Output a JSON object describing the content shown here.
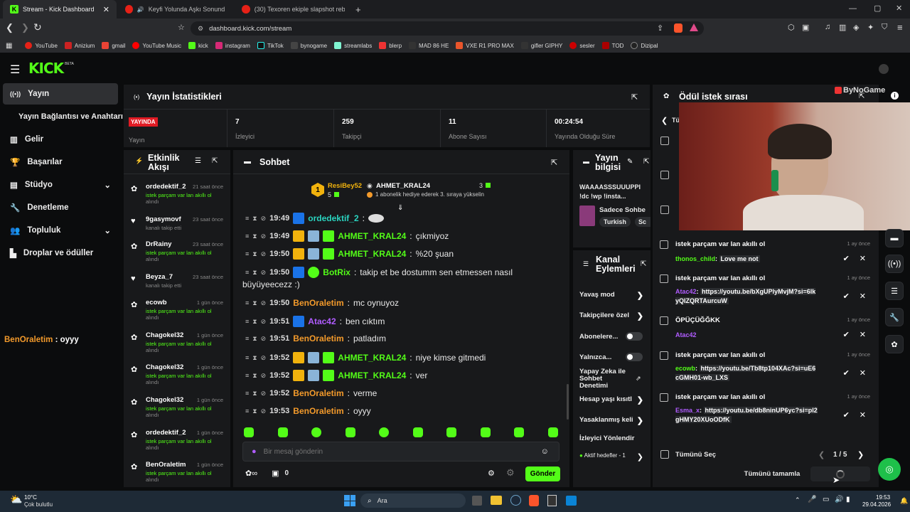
{
  "browser": {
    "tabs": [
      {
        "title": "Stream - Kick Dashboard",
        "active": true
      },
      {
        "title": "Keyfi Yolunda Aşkı Sonunda | Yo",
        "active": false
      },
      {
        "title": "(30) Texoren ekiple slapshot rebound",
        "active": false
      }
    ],
    "url": "dashboard.kick.com/stream",
    "bookmarks": [
      "YouTube",
      "Anizium",
      "gmail",
      "YouTube Music",
      "kick",
      "instagram",
      "TikTok",
      "bynogame",
      "streamlabs",
      "blerp",
      "MAD 86 HE",
      "VXE R1 PRO MAX",
      "gifler GIPHY",
      "sesler",
      "TOD",
      "Dizipal"
    ]
  },
  "app": {
    "logo": "KICK",
    "logo_sup": "BETA"
  },
  "sidebar": {
    "items": [
      {
        "label": "Yayın",
        "icon": "broadcast-icon"
      },
      {
        "label": "Yayın Bağlantısı ve Anahtarı",
        "icon": ""
      },
      {
        "label": "Gelir",
        "icon": "chart-icon"
      },
      {
        "label": "Başarılar",
        "icon": "trophy-icon"
      },
      {
        "label": "Stüdyo",
        "icon": "monitor-icon"
      },
      {
        "label": "Denetleme",
        "icon": "wrench-icon"
      },
      {
        "label": "Topluluk",
        "icon": "people-icon"
      },
      {
        "label": "Droplar ve ödüller",
        "icon": "gift-icon"
      }
    ],
    "overlay_chat": {
      "user": "BenOraletim",
      "text": " : oyyy"
    }
  },
  "stats": {
    "title": "Yayın İstatistikleri",
    "live_badge": "YAYINDA",
    "live_label": "Yayın",
    "items": [
      {
        "value": "7",
        "label": "İzleyici"
      },
      {
        "value": "259",
        "label": "Takipçi"
      },
      {
        "value": "11",
        "label": "Abone Sayısı"
      },
      {
        "value": "00:24:54",
        "label": "Yayında Olduğu Süre"
      }
    ]
  },
  "activity": {
    "title": "Etkinlik Akışı",
    "items": [
      {
        "name": "ordedektif_2",
        "time": "21 saat önce",
        "sub": "istek parçam var lan akıllı ol",
        "sub2": "alındı",
        "type": "reward"
      },
      {
        "name": "9gasymovf",
        "time": "23 saat önce",
        "sub": "",
        "sub2": "kanalı takip etti",
        "type": "follow"
      },
      {
        "name": "DrRainy",
        "time": "23 saat önce",
        "sub": "istek parçam var lan akıllı ol",
        "sub2": "alındı",
        "type": "reward"
      },
      {
        "name": "Beyza_7",
        "time": "23 saat önce",
        "sub": "",
        "sub2": "kanalı takip etti",
        "type": "follow"
      },
      {
        "name": "ecowb",
        "time": "1 gün önce",
        "sub": "istek parçam var lan akıllı ol",
        "sub2": "alındı",
        "type": "reward"
      },
      {
        "name": "Chagokel32",
        "time": "1 gün önce",
        "sub": "istek parçam var lan akıllı ol",
        "sub2": "alındı",
        "type": "reward"
      },
      {
        "name": "Chagokel32",
        "time": "1 gün önce",
        "sub": "istek parçam var lan akıllı ol",
        "sub2": "alındı",
        "type": "reward"
      },
      {
        "name": "Chagokel32",
        "time": "1 gün önce",
        "sub": "istek parçam var lan akıllı ol",
        "sub2": "alındı",
        "type": "reward"
      },
      {
        "name": "ordedektif_2",
        "time": "1 gün önce",
        "sub": "istek parçam var lan akıllı ol",
        "sub2": "alındı",
        "type": "reward"
      },
      {
        "name": "BenOraletim",
        "time": "1 gün önce",
        "sub": "istek parçam var lan akıllı ol",
        "sub2": "alındı",
        "type": "reward"
      }
    ]
  },
  "chat": {
    "title": "Sohbet",
    "pinned": {
      "rank": "1",
      "gifter": "ResiBey52",
      "gifter_count": "5",
      "recipient": "AHMET_KRAL24",
      "recipient_count": "3",
      "text": "1 abonelik hediye ederek 3. sıraya yükselin"
    },
    "messages": [
      {
        "time": "19:49",
        "user": "ordedektif_2",
        "text": "",
        "color": "teal",
        "badges": [
          "mod"
        ],
        "emote": true
      },
      {
        "time": "19:49",
        "user": "AHMET_KRAL24",
        "text": "çıkmiyoz",
        "color": "green",
        "badges": [
          "crown",
          "face",
          "sub"
        ]
      },
      {
        "time": "19:50",
        "user": "AHMET_KRAL24",
        "text": "%20 şuan",
        "color": "green",
        "badges": [
          "crown",
          "face",
          "sub"
        ]
      },
      {
        "time": "19:50",
        "user": "BotRix",
        "text": "takip et be dostumm sen etmessen nasıl",
        "text2": "büyüyeecezz :)",
        "color": "green",
        "badges": [
          "mod",
          "ver"
        ]
      },
      {
        "time": "19:50",
        "user": "BenOraletim",
        "text": "mc oynuyoz",
        "color": "orange",
        "badges": []
      },
      {
        "time": "19:51",
        "user": "Atac42",
        "text": "ben cıktım",
        "color": "purple",
        "badges": [
          "mod"
        ]
      },
      {
        "time": "19:51",
        "user": "BenOraletim",
        "text": "patladım",
        "color": "orange",
        "badges": []
      },
      {
        "time": "19:52",
        "user": "AHMET_KRAL24",
        "text": "niye kimse gitmedi",
        "color": "green",
        "badges": [
          "crown",
          "face",
          "sub"
        ]
      },
      {
        "time": "19:52",
        "user": "AHMET_KRAL24",
        "text": "ver",
        "color": "green",
        "badges": [
          "crown",
          "face",
          "sub"
        ]
      },
      {
        "time": "19:52",
        "user": "BenOraletim",
        "text": "verme",
        "color": "orange",
        "badges": []
      },
      {
        "time": "19:53",
        "user": "BenOraletim",
        "text": "oyyy",
        "color": "orange",
        "badges": []
      }
    ],
    "input_placeholder": "Bir mesaj gönderin",
    "points": "0",
    "send_label": "Gönder"
  },
  "stream_info": {
    "title": "Yayın bilgisi",
    "stream_title": "WAAAASSSUUUPPI !dc !wp !insta...",
    "category": "Sadece Sohbe",
    "tags": [
      "Turkish",
      "Sc"
    ]
  },
  "channel_actions": {
    "title": "Kanal Eylemleri",
    "items": [
      {
        "label": "Yavaş mod",
        "kind": "chevron"
      },
      {
        "label": "Takipçilere özel",
        "kind": "chevron"
      },
      {
        "label": "Abonelere...",
        "kind": "toggle"
      },
      {
        "label": "Yalnızca...",
        "kind": "toggle"
      },
      {
        "label": "Yapay Zeka ile Sohbet Denetimi",
        "kind": "external"
      },
      {
        "label": "Hesap yaşı kısıtl",
        "kind": "chevron"
      },
      {
        "label": "Yasaklanmış keli",
        "kind": "chevron"
      },
      {
        "label": "İzleyici Yönlendir",
        "kind": "none"
      },
      {
        "label": "Aktif hedefler - 1",
        "kind": "chevron"
      }
    ]
  },
  "requests": {
    "title": "Ödül istek sırası",
    "back_label": "Tü",
    "items": [
      {
        "title": "istek parçam var lan akıllı ol",
        "time": "1 ay önce",
        "user": "thonos_child",
        "user_color": "#53fc18",
        "msg": "Love me not"
      },
      {
        "title": "istek parçam var lan akıllı ol",
        "time": "1 ay önce",
        "user": "Atac42",
        "user_color": "#b05cff",
        "msg": "https://youtu.be/bXgUPlyMvjM?si=6lkyQIZQRTAurcuW"
      },
      {
        "title": "ÖPÜÇÜĞĞKK",
        "time": "1 ay önce",
        "user": "Atac42",
        "user_color": "#b05cff",
        "msg": ""
      },
      {
        "title": "istek parçam var lan akıllı ol",
        "time": "1 ay önce",
        "user": "ecowb",
        "user_color": "#53fc18",
        "msg": "https://youtu.be/Tb8tp104XAc?si=uE6cGMH01-wb_LXS"
      },
      {
        "title": "istek parçam var lan akıllı ol",
        "time": "1 ay önce",
        "user": "Esma_x",
        "user_color": "#b05cff",
        "msg": "https://youtu.be/db8ninUP6yc?si=pl2gHMY20XUoODfK"
      }
    ],
    "select_all": "Tümünü Seç",
    "page": "1 / 5",
    "complete_all": "Tümünü tamamla"
  },
  "overlay": {
    "brand": "ByNoGame"
  },
  "taskbar": {
    "weather_temp": "10°C",
    "weather_desc": "Çok bulutlu",
    "search": "Ara",
    "time": "19:53",
    "date": "29.04.2026"
  },
  "colors": {
    "accent": "#53fc18",
    "panel": "#18191b",
    "bg": "#0b0c0d"
  }
}
